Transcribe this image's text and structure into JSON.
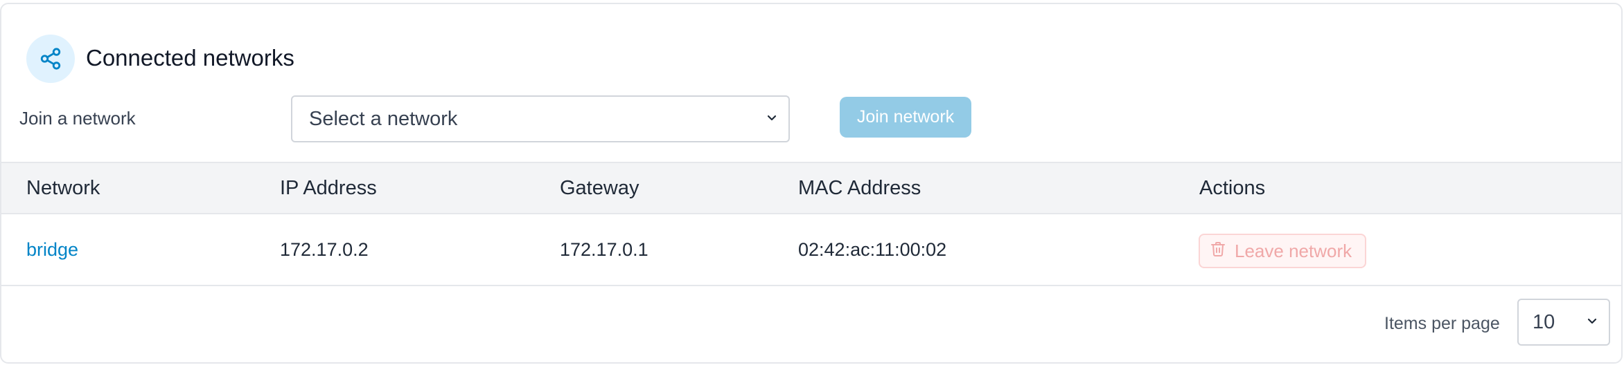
{
  "header": {
    "title": "Connected networks",
    "icon": "share-network-icon"
  },
  "join": {
    "label": "Join a network",
    "select_value": "Select a network",
    "button_label": "Join network"
  },
  "table": {
    "columns": [
      "Network",
      "IP Address",
      "Gateway",
      "MAC Address",
      "Actions"
    ],
    "rows": [
      {
        "network": "bridge",
        "ip": "172.17.0.2",
        "gateway": "172.17.0.1",
        "mac": "02:42:ac:11:00:02",
        "action_label": "Leave network"
      }
    ]
  },
  "pagination": {
    "label": "Items per page",
    "value": "10"
  },
  "colors": {
    "accent": "#0284c7",
    "join_button": "#93cbe6",
    "danger_text": "#f0a8a8"
  }
}
